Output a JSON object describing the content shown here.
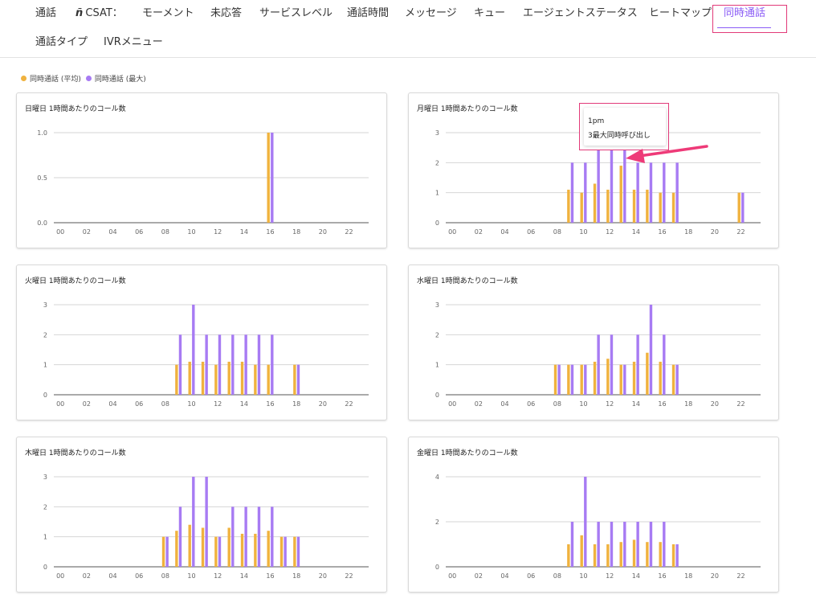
{
  "tabs": [
    {
      "label": "通話",
      "active": false
    },
    {
      "label": "CSAT：",
      "logo": "ñ",
      "active": false
    },
    {
      "label": "モーメント",
      "active": false
    },
    {
      "label": "未応答",
      "active": false
    },
    {
      "label": "サービスレベル",
      "active": false
    },
    {
      "label": "通話時間",
      "active": false
    },
    {
      "label": "メッセージ",
      "active": false
    },
    {
      "label": "キュー",
      "active": false
    },
    {
      "label": "エージェントステータス",
      "active": false
    },
    {
      "label": "ヒートマップ",
      "active": false
    },
    {
      "label": "同時通話",
      "active": true
    },
    {
      "label": "通話タイプ",
      "active": false
    },
    {
      "label": "IVRメニュー",
      "active": false
    }
  ],
  "legend": [
    {
      "label": "同時通話 (平均)",
      "color": "#f0b23e"
    },
    {
      "label": "同時通話 (最大)",
      "color": "#a77bf3"
    }
  ],
  "tooltip": {
    "title": "1pm",
    "text": "3最大同時呼び出し"
  },
  "chart_data": [
    {
      "type": "bar",
      "title": "日曜日 1時間あたりのコール数",
      "categories": [
        "00",
        "01",
        "02",
        "03",
        "04",
        "05",
        "06",
        "07",
        "08",
        "09",
        "10",
        "11",
        "12",
        "13",
        "14",
        "15",
        "16",
        "17",
        "18",
        "19",
        "20",
        "21",
        "22",
        "23"
      ],
      "x_tick_labels": [
        "00",
        "02",
        "04",
        "06",
        "08",
        "10",
        "12",
        "14",
        "16",
        "18",
        "20",
        "22"
      ],
      "y_tick_labels": [
        "0.0",
        "0.5",
        "1.0"
      ],
      "ylim": [
        0,
        1
      ],
      "series": [
        {
          "name": "同時通話 (平均)",
          "values": [
            0,
            0,
            0,
            0,
            0,
            0,
            0,
            0,
            0,
            0,
            0,
            0,
            0,
            0,
            0,
            0,
            1,
            0,
            0,
            0,
            0,
            0,
            0,
            0
          ]
        },
        {
          "name": "同時通話 (最大)",
          "values": [
            0,
            0,
            0,
            0,
            0,
            0,
            0,
            0,
            0,
            0,
            0,
            0,
            0,
            0,
            0,
            0,
            1,
            0,
            0,
            0,
            0,
            0,
            0,
            0
          ]
        }
      ]
    },
    {
      "type": "bar",
      "title": "月曜日 1時間あたりのコール数",
      "categories": [
        "00",
        "01",
        "02",
        "03",
        "04",
        "05",
        "06",
        "07",
        "08",
        "09",
        "10",
        "11",
        "12",
        "13",
        "14",
        "15",
        "16",
        "17",
        "18",
        "19",
        "20",
        "21",
        "22",
        "23"
      ],
      "x_tick_labels": [
        "00",
        "02",
        "04",
        "06",
        "08",
        "10",
        "12",
        "14",
        "16",
        "18",
        "20",
        "22"
      ],
      "y_tick_labels": [
        "0",
        "1",
        "2",
        "3"
      ],
      "ylim": [
        0,
        3
      ],
      "series": [
        {
          "name": "同時通話 (平均)",
          "values": [
            0,
            0,
            0,
            0,
            0,
            0,
            0,
            0,
            0,
            1.1,
            1,
            1.3,
            1.1,
            1.9,
            1.1,
            1.1,
            1,
            1,
            0,
            0,
            0,
            0,
            1,
            0
          ]
        },
        {
          "name": "同時通話 (最大)",
          "values": [
            0,
            0,
            0,
            0,
            0,
            0,
            0,
            0,
            0,
            2,
            2,
            3,
            3,
            3,
            2,
            2,
            2,
            2,
            0,
            0,
            0,
            0,
            1,
            0
          ]
        }
      ]
    },
    {
      "type": "bar",
      "title": "火曜日 1時間あたりのコール数",
      "categories": [
        "00",
        "01",
        "02",
        "03",
        "04",
        "05",
        "06",
        "07",
        "08",
        "09",
        "10",
        "11",
        "12",
        "13",
        "14",
        "15",
        "16",
        "17",
        "18",
        "19",
        "20",
        "21",
        "22",
        "23"
      ],
      "x_tick_labels": [
        "00",
        "02",
        "04",
        "06",
        "08",
        "10",
        "12",
        "14",
        "16",
        "18",
        "20",
        "22"
      ],
      "y_tick_labels": [
        "0",
        "1",
        "2",
        "3"
      ],
      "ylim": [
        0,
        3
      ],
      "series": [
        {
          "name": "同時通話 (平均)",
          "values": [
            0,
            0,
            0,
            0,
            0,
            0,
            0,
            0,
            0,
            1,
            1.1,
            1.1,
            1,
            1.1,
            1.1,
            1,
            1,
            0,
            1,
            0,
            0,
            0,
            0,
            0
          ]
        },
        {
          "name": "同時通話 (最大)",
          "values": [
            0,
            0,
            0,
            0,
            0,
            0,
            0,
            0,
            0,
            2,
            3,
            2,
            2,
            2,
            2,
            2,
            2,
            0,
            1,
            0,
            0,
            0,
            0,
            0
          ]
        }
      ]
    },
    {
      "type": "bar",
      "title": "水曜日 1時間あたりのコール数",
      "categories": [
        "00",
        "01",
        "02",
        "03",
        "04",
        "05",
        "06",
        "07",
        "08",
        "09",
        "10",
        "11",
        "12",
        "13",
        "14",
        "15",
        "16",
        "17",
        "18",
        "19",
        "20",
        "21",
        "22",
        "23"
      ],
      "x_tick_labels": [
        "00",
        "02",
        "04",
        "06",
        "08",
        "10",
        "12",
        "14",
        "16",
        "18",
        "20",
        "22"
      ],
      "y_tick_labels": [
        "0",
        "1",
        "2",
        "3"
      ],
      "ylim": [
        0,
        3
      ],
      "series": [
        {
          "name": "同時通話 (平均)",
          "values": [
            0,
            0,
            0,
            0,
            0,
            0,
            0,
            0,
            1,
            1,
            1,
            1.1,
            1.2,
            1,
            1.1,
            1.4,
            1.1,
            1,
            0,
            0,
            0,
            0,
            0,
            0
          ]
        },
        {
          "name": "同時通話 (最大)",
          "values": [
            0,
            0,
            0,
            0,
            0,
            0,
            0,
            0,
            1,
            1,
            1,
            2,
            2,
            1,
            2,
            3,
            2,
            1,
            0,
            0,
            0,
            0,
            0,
            0
          ]
        }
      ]
    },
    {
      "type": "bar",
      "title": "木曜日 1時間あたりのコール数",
      "categories": [
        "00",
        "01",
        "02",
        "03",
        "04",
        "05",
        "06",
        "07",
        "08",
        "09",
        "10",
        "11",
        "12",
        "13",
        "14",
        "15",
        "16",
        "17",
        "18",
        "19",
        "20",
        "21",
        "22",
        "23"
      ],
      "x_tick_labels": [
        "00",
        "02",
        "04",
        "06",
        "08",
        "10",
        "12",
        "14",
        "16",
        "18",
        "20",
        "22"
      ],
      "y_tick_labels": [
        "0",
        "1",
        "2",
        "3"
      ],
      "ylim": [
        0,
        3
      ],
      "series": [
        {
          "name": "同時通話 (平均)",
          "values": [
            0,
            0,
            0,
            0,
            0,
            0,
            0,
            0,
            1,
            1.2,
            1.4,
            1.3,
            1,
            1.3,
            1.1,
            1.1,
            1.2,
            1,
            1,
            0,
            0,
            0,
            0,
            0
          ]
        },
        {
          "name": "同時通話 (最大)",
          "values": [
            0,
            0,
            0,
            0,
            0,
            0,
            0,
            0,
            1,
            2,
            3,
            3,
            1,
            2,
            2,
            2,
            2,
            1,
            1,
            0,
            0,
            0,
            0,
            0
          ]
        }
      ]
    },
    {
      "type": "bar",
      "title": "金曜日 1時間あたりのコール数",
      "categories": [
        "00",
        "01",
        "02",
        "03",
        "04",
        "05",
        "06",
        "07",
        "08",
        "09",
        "10",
        "11",
        "12",
        "13",
        "14",
        "15",
        "16",
        "17",
        "18",
        "19",
        "20",
        "21",
        "22",
        "23"
      ],
      "x_tick_labels": [
        "00",
        "02",
        "04",
        "06",
        "08",
        "10",
        "12",
        "14",
        "16",
        "18",
        "20",
        "22"
      ],
      "y_tick_labels": [
        "0",
        "2",
        "4"
      ],
      "ylim": [
        0,
        4
      ],
      "series": [
        {
          "name": "同時通話 (平均)",
          "values": [
            0,
            0,
            0,
            0,
            0,
            0,
            0,
            0,
            0,
            1,
            1.4,
            1,
            1,
            1.1,
            1.2,
            1.1,
            1.1,
            1,
            0,
            0,
            0,
            0,
            0,
            0
          ]
        },
        {
          "name": "同時通話 (最大)",
          "values": [
            0,
            0,
            0,
            0,
            0,
            0,
            0,
            0,
            0,
            2,
            4,
            2,
            2,
            2,
            2,
            2,
            2,
            1,
            0,
            0,
            0,
            0,
            0,
            0
          ]
        }
      ]
    }
  ]
}
